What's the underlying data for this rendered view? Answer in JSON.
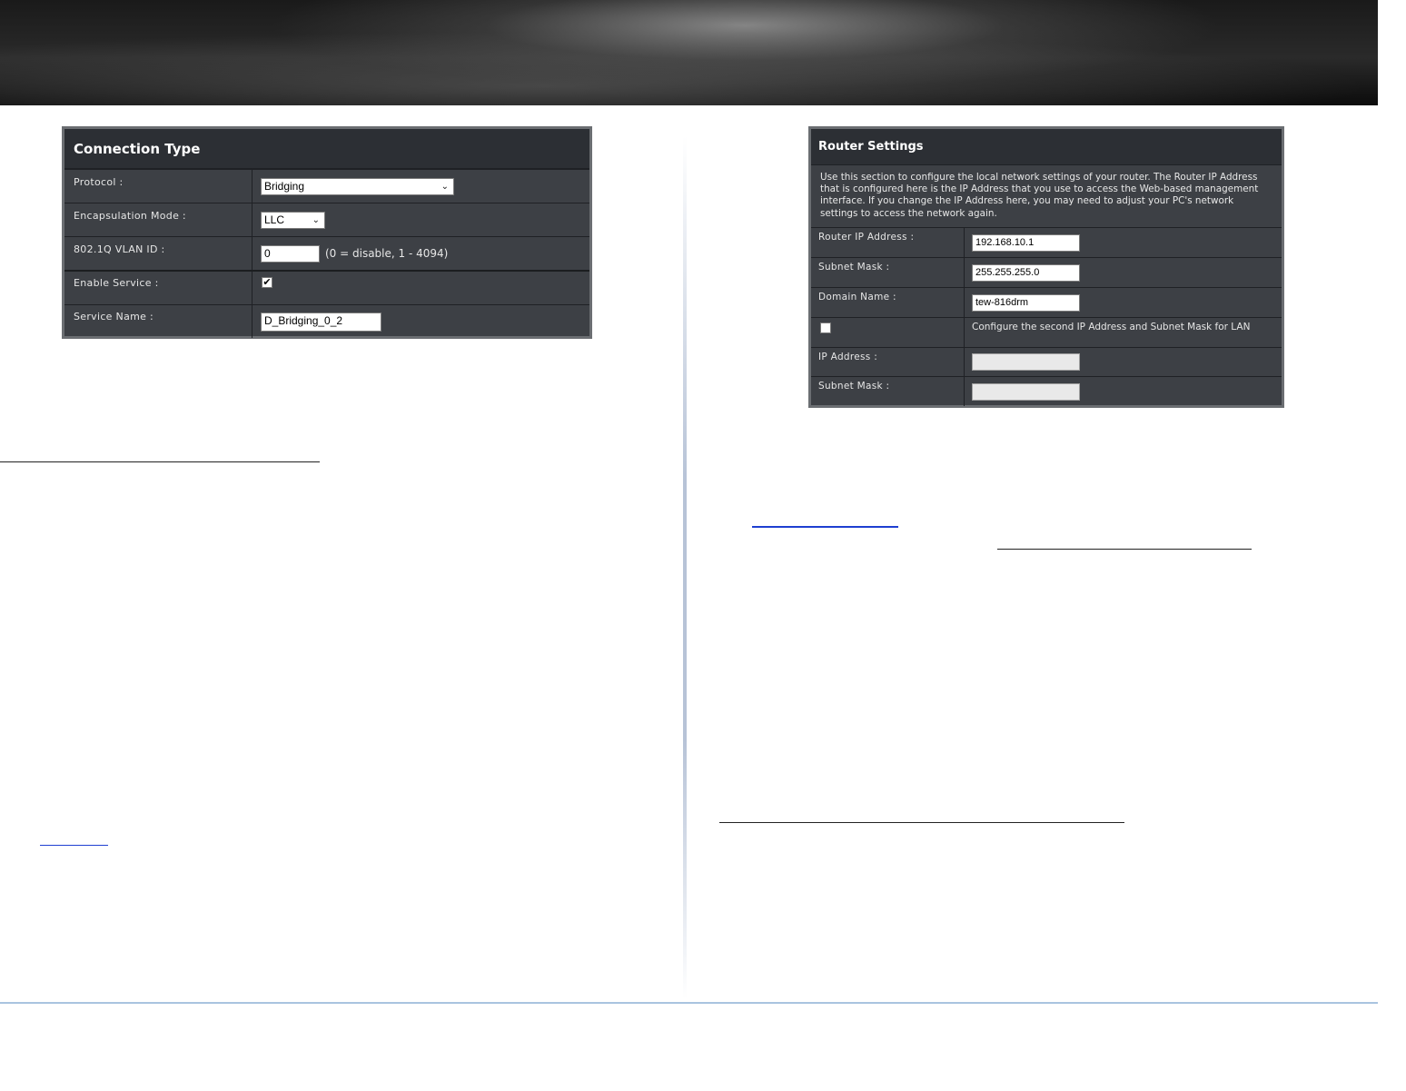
{
  "connection_type": {
    "title": "Connection Type",
    "protocol_label": "Protocol :",
    "protocol_value": "Bridging",
    "encapsulation_label": "Encapsulation Mode :",
    "encapsulation_value": "LLC",
    "vlan_label": "802.1Q VLAN ID :",
    "vlan_value": "0",
    "vlan_hint": "(0 = disable, 1 - 4094)",
    "enable_label": "Enable Service :",
    "enable_checked": true,
    "enable_mark": "✔",
    "service_label": "Service Name :",
    "service_value": "D_Bridging_0_2"
  },
  "router_settings": {
    "title": "Router Settings",
    "description": "Use this section to configure the local network settings of your router. The Router IP Address that is configured here is the IP Address that you use to access the Web-based management interface. If you change the IP Address here, you may need to adjust your PC's network settings to access the network again.",
    "router_ip_label": "Router IP Address :",
    "router_ip_value": "192.168.10.1",
    "subnet_label": "Subnet Mask :",
    "subnet_value": "255.255.255.0",
    "domain_label": "Domain Name :",
    "domain_value": "tew-816drm",
    "second_ip_checked": false,
    "second_ip_text": "Configure the second IP Address and Subnet Mask for LAN",
    "ip2_label": "IP Address :",
    "ip2_value": "",
    "mask2_label": "Subnet Mask :",
    "mask2_value": ""
  },
  "icons": {
    "dropdown": "chevron-down-icon",
    "checkbox": "checkmark-icon"
  },
  "colors": {
    "panel_bg": "#3d4045",
    "panel_header": "#2c2f34",
    "link_underline": "#1f3fd1",
    "footer_line": "#a9c4e0"
  }
}
